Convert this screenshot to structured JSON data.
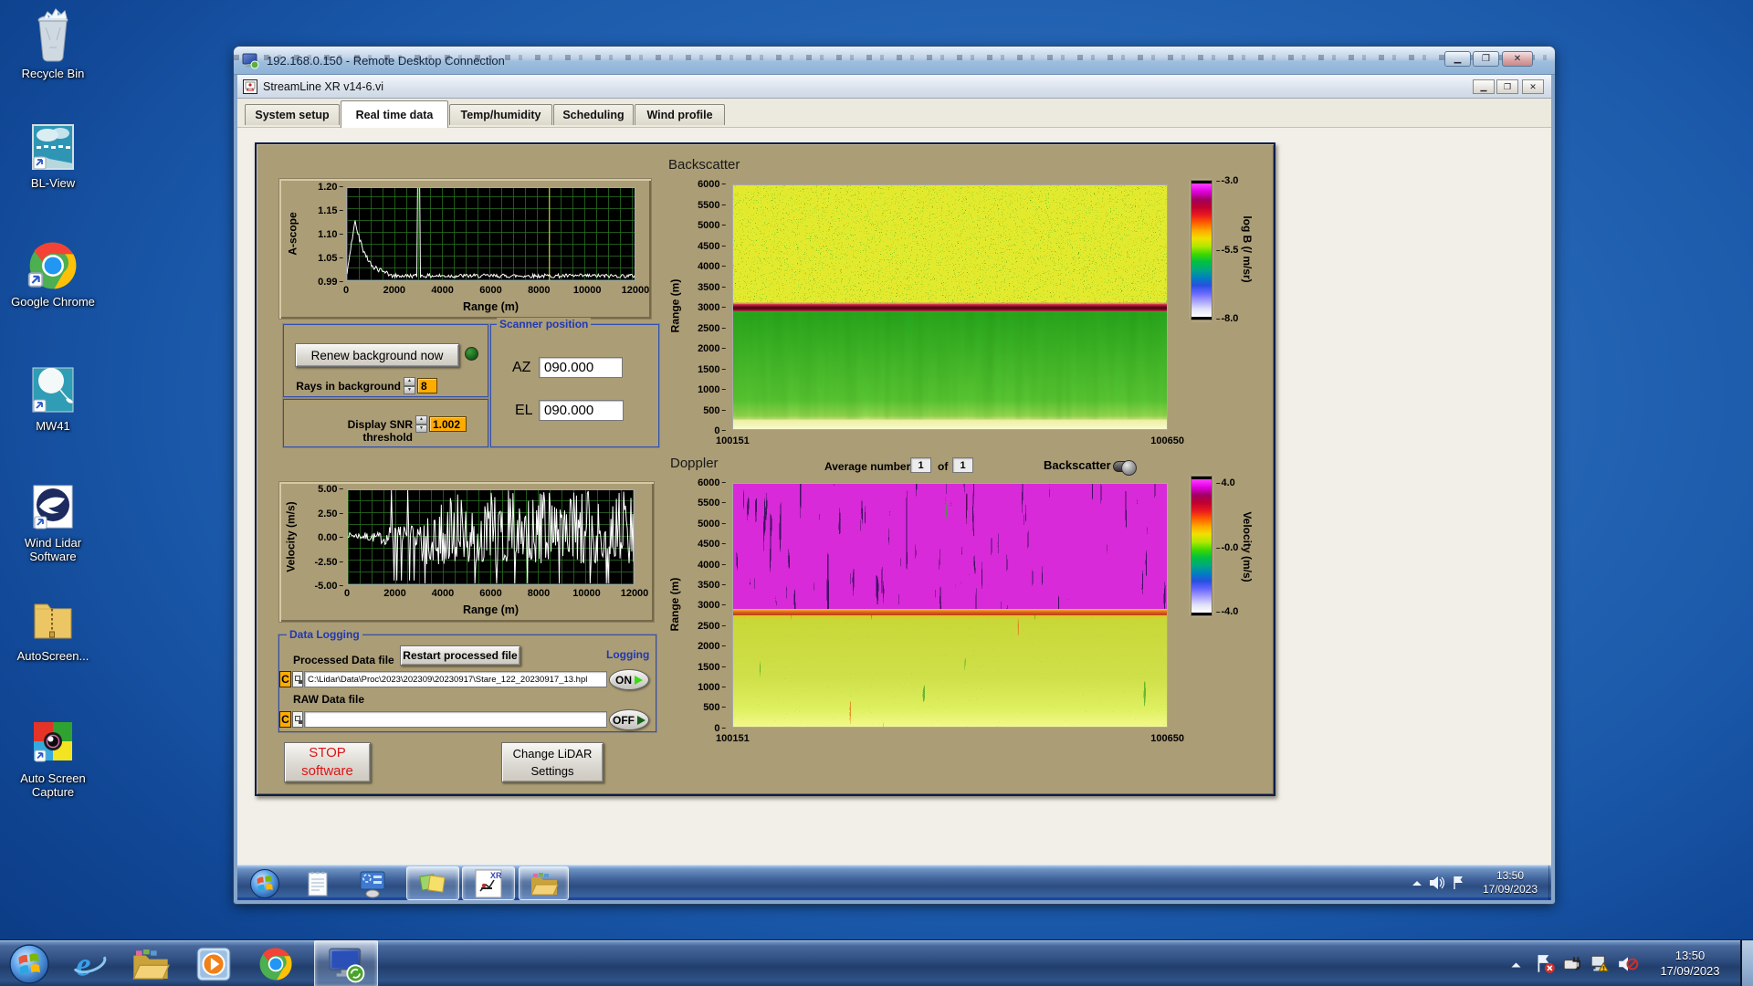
{
  "desktop": {
    "icons": [
      {
        "id": "recycle-bin",
        "label": "Recycle Bin"
      },
      {
        "id": "bl-view",
        "label": "BL-View"
      },
      {
        "id": "google-chrome",
        "label": "Google Chrome"
      },
      {
        "id": "mw41",
        "label": "MW41"
      },
      {
        "id": "wind-lidar-software",
        "label": "Wind Lidar Software"
      },
      {
        "id": "autoscreen",
        "label": "AutoScreen..."
      },
      {
        "id": "auto-screen-capture",
        "label": "Auto Screen Capture"
      }
    ]
  },
  "rdp": {
    "title": "192.168.0.150 - Remote Desktop Connection"
  },
  "vi": {
    "title": "StreamLine XR v14-6.vi",
    "tabs": [
      {
        "label": "System setup",
        "active": false
      },
      {
        "label": "Real time data",
        "active": true
      },
      {
        "label": "Temp/humidity",
        "active": false
      },
      {
        "label": "Scheduling",
        "active": false
      },
      {
        "label": "Wind profile",
        "active": false
      }
    ]
  },
  "panel": {
    "backscatter_title": "Backscatter",
    "doppler_title": "Doppler",
    "average_label": "Average number",
    "average_value": "1",
    "of_label": "of",
    "of_value": "1",
    "backscatter_toggle_label": "Backscatter",
    "renew_button": "Renew background now",
    "rays_label": "Rays in background",
    "rays_value": "8",
    "snr_label": "Display SNR threshold",
    "snr_value": "1.002",
    "scanner_title": "Scanner position",
    "az_label": "AZ",
    "az_value": "090.000",
    "el_label": "EL",
    "el_value": "090.000",
    "logging": {
      "box_title": "Data Logging",
      "processed_label": "Processed Data file",
      "restart_button": "Restart processed file",
      "logging_label": "Logging",
      "drive_letter": "C",
      "processed_path": "C:\\Lidar\\Data\\Proc\\2023\\202309\\20230917\\Stare_122_20230917_13.hpl",
      "raw_label": "RAW Data file",
      "raw_path": "",
      "on_label": "ON",
      "off_label": "OFF"
    },
    "stop_button_line1": "STOP",
    "stop_button_line2": "software",
    "change_button_line1": "Change LiDAR",
    "change_button_line2": "Settings"
  },
  "remote_taskbar": {
    "clock_time": "13:50",
    "clock_date": "17/09/2023"
  },
  "host_taskbar": {
    "clock_time": "13:50",
    "clock_date": "17/09/2023"
  },
  "chart_data": [
    {
      "id": "ascope",
      "type": "line",
      "title": "",
      "ylabel": "A-scope",
      "xlabel": "Range (m)",
      "ylim": [
        0.99,
        1.2
      ],
      "xlim": [
        0,
        12000
      ],
      "yticks": [
        "1.20",
        "1.15",
        "1.10",
        "1.05",
        "0.99"
      ],
      "xticks": [
        "0",
        "2000",
        "4000",
        "6000",
        "8000",
        "10000",
        "12000"
      ],
      "bg": "#000000",
      "grid_color": "#2c7422",
      "trace_color": "#ffffff",
      "cursor_color": "#e8e83a",
      "cursor_x": 8450,
      "series": [
        {
          "name": "a-scope",
          "keypoints": [
            [
              0,
              1.01
            ],
            [
              350,
              1.13
            ],
            [
              900,
              1.035
            ],
            [
              1600,
              1.0
            ],
            [
              2950,
              1.0
            ],
            [
              3000,
              1.2
            ],
            [
              3060,
              1.0
            ],
            [
              12000,
              1.0
            ]
          ],
          "noise": 0.005
        }
      ]
    },
    {
      "id": "velocity",
      "type": "line",
      "title": "",
      "ylabel": "Velocity (m/s)",
      "xlabel": "Range (m)",
      "ylim": [
        -5,
        5
      ],
      "xlim": [
        0,
        12000
      ],
      "yticks": [
        "5.00",
        "2.50",
        "0.00",
        "-2.50",
        "-5.00"
      ],
      "xticks": [
        "0",
        "2000",
        "4000",
        "6000",
        "8000",
        "10000",
        "12000"
      ],
      "bg": "#000000",
      "grid_color": "#2c7422",
      "trace_color": "#ffffff",
      "series": [
        {
          "name": "velocity",
          "description": "near-zero noise to ~1700 m, growing noise 1700-3100 m, saturated +/-5 m/s spikes beyond 3100 m"
        }
      ]
    },
    {
      "id": "backscatter",
      "type": "heatmap",
      "title": "Backscatter",
      "ylabel": "Range (m)",
      "ylim": [
        0,
        6000
      ],
      "yticks": [
        "6000",
        "5500",
        "5000",
        "4500",
        "4000",
        "3500",
        "3000",
        "2500",
        "2000",
        "1500",
        "1000",
        "500",
        "0"
      ],
      "x_start": "100151",
      "x_end": "100650",
      "colorbar": {
        "label": "log B (/ m/sr)",
        "ticks": [
          "-3.0",
          "-5.5",
          "-8.0"
        ],
        "colors": [
          "#ff40ff",
          "#e000e0",
          "#a00060",
          "#c00030",
          "#e81820",
          "#ff5c00",
          "#ffa800",
          "#f0e000",
          "#b0e800",
          "#40d800",
          "#00c040",
          "#00a880",
          "#0080c0",
          "#2850e0",
          "#6868ff",
          "#a8a0ff",
          "#e0e0f8",
          "#ffffff"
        ]
      },
      "features": [
        "yellow-green speckle noise above 3000 m",
        "dark red aerosol layer band at ~3000 m",
        "smooth green field below 3000 m",
        "bright yellow near-surface return below ~400 m"
      ]
    },
    {
      "id": "doppler",
      "type": "heatmap",
      "title": "Doppler",
      "ylabel": "Range (m)",
      "ylim": [
        0,
        6000
      ],
      "yticks": [
        "6000",
        "5500",
        "5000",
        "4500",
        "4000",
        "3500",
        "3000",
        "2500",
        "2000",
        "1500",
        "1000",
        "500",
        "0"
      ],
      "x_start": "100151",
      "x_end": "100650",
      "colorbar": {
        "label": "Velocity (m/s)",
        "ticks": [
          "4.0",
          "-0.0",
          "-4.0"
        ],
        "colors": [
          "#ff40ff",
          "#e000e0",
          "#a00060",
          "#c00030",
          "#e81820",
          "#ff5c00",
          "#ffa800",
          "#f0e000",
          "#b0e800",
          "#40d800",
          "#00c040",
          "#00a880",
          "#0080c0",
          "#2850e0",
          "#6868ff",
          "#a8a0ff",
          "#e0e0f8",
          "#ffffff"
        ]
      },
      "features": [
        "magenta noise with dark vertical streaks above 3000 m",
        "multicolour transition at ~3000 m",
        "yellow-green mottle with orange/green streaks below 3000 m",
        "bright yellow-green near surface"
      ]
    }
  ]
}
